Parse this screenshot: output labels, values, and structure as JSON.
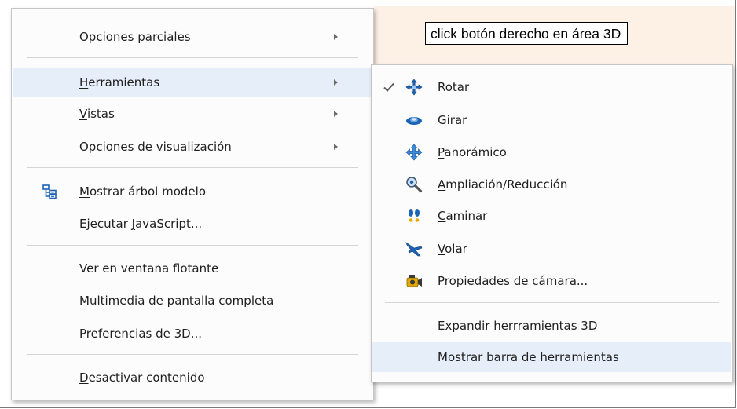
{
  "callout": {
    "text": "click botón derecho en área 3D"
  },
  "main_menu": {
    "items": [
      {
        "pre": "Opciones parciales",
        "u": "",
        "post": "",
        "has_submenu": true
      },
      {
        "pre": "",
        "u": "H",
        "post": "erramientas",
        "has_submenu": true,
        "highlighted": true
      },
      {
        "pre": "",
        "u": "V",
        "post": "istas",
        "has_submenu": true
      },
      {
        "pre": "Opciones de visualización",
        "u": "",
        "post": "",
        "has_submenu": true
      },
      {
        "pre": "",
        "u": "M",
        "post": "ostrar árbol modelo",
        "icon": "model-tree-icon"
      },
      {
        "pre": "Ejecutar ",
        "u": "J",
        "post": "avaScript..."
      },
      {
        "pre": "Ver en ventana flotante",
        "u": "",
        "post": ""
      },
      {
        "pre": "Multimedia de pantalla completa",
        "u": "",
        "post": ""
      },
      {
        "pre": "Preferencias de 3D...",
        "u": "",
        "post": ""
      },
      {
        "pre": "",
        "u": "D",
        "post": "esactivar contenido"
      }
    ]
  },
  "sub_menu": {
    "items": [
      {
        "pre": "",
        "u": "R",
        "post": "otar",
        "icon": "rotate-icon",
        "checked": true
      },
      {
        "pre": "",
        "u": "G",
        "post": "irar",
        "icon": "spin-icon"
      },
      {
        "pre": "",
        "u": "P",
        "post": "anorámico",
        "icon": "pan-icon"
      },
      {
        "pre": "",
        "u": "A",
        "post": "mpliación/Reducción",
        "icon": "zoom-icon"
      },
      {
        "pre": "",
        "u": "C",
        "post": "aminar",
        "icon": "walk-icon"
      },
      {
        "pre": "",
        "u": "V",
        "post": "olar",
        "icon": "fly-icon"
      },
      {
        "pre": "Propiedades de cámara...",
        "u": "",
        "post": "",
        "icon": "camera-icon"
      },
      {
        "pre": "Expandir herrramientas 3D",
        "u": "",
        "post": ""
      },
      {
        "pre": "Mostrar ",
        "u": "b",
        "post": "arra de herramientas",
        "highlighted": true
      }
    ]
  },
  "colors": {
    "highlight": "#e6eef9",
    "background_3d": "#fdf1e6",
    "icon_blue": "#1d63b5"
  }
}
